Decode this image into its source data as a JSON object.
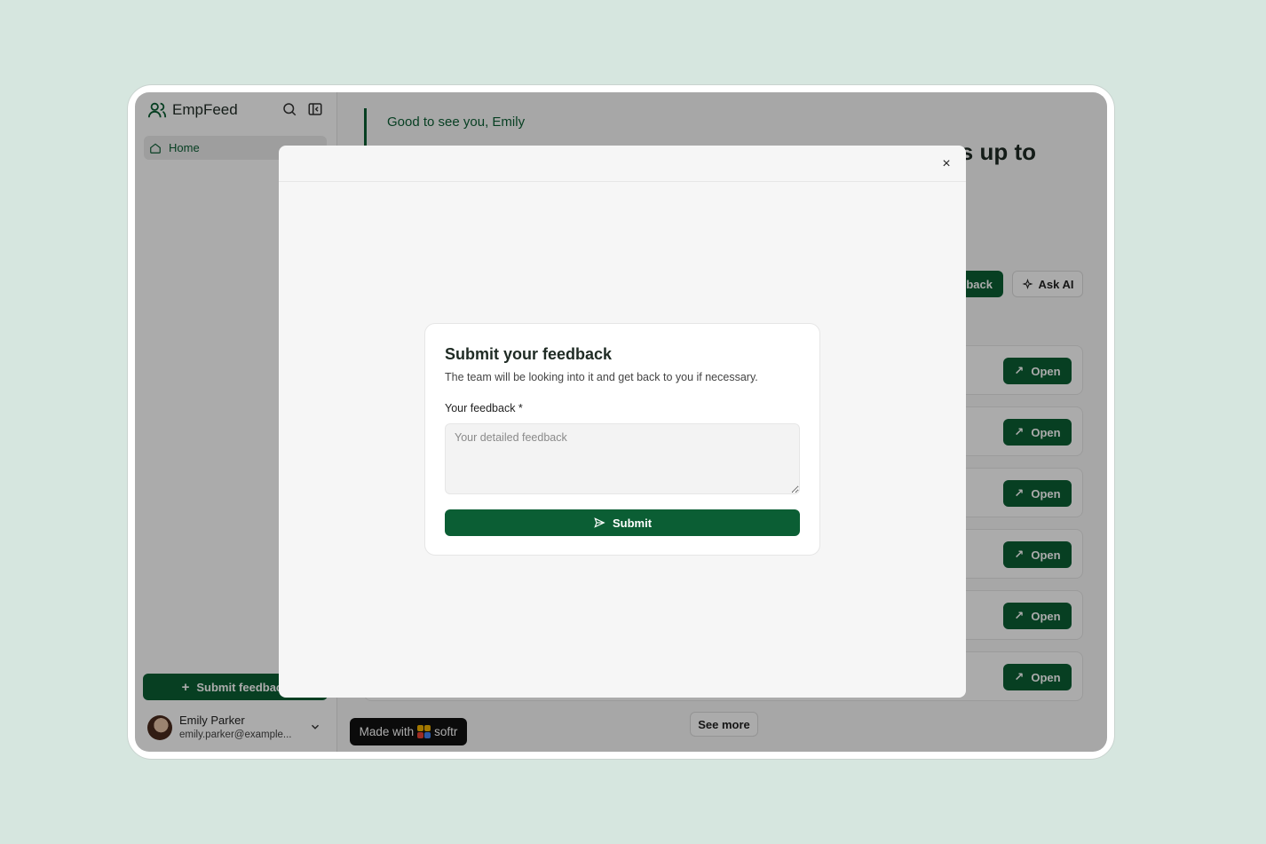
{
  "app": {
    "name": "EmpFeed"
  },
  "sidebar": {
    "nav_items": [
      {
        "label": "Home",
        "icon": "home-icon"
      }
    ],
    "submit_feedback_label": "Submit feedback",
    "user": {
      "name": "Emily Parker",
      "email": "emily.parker@example..."
    }
  },
  "main": {
    "greeting": "Good to see you, Emily",
    "headline_visible_tail": "s up to",
    "give_feedback_label": "back",
    "ask_ai_label": "Ask AI",
    "open_label": "Open",
    "see_more_label": "See more",
    "made_with_label": "Made with",
    "made_with_brand": "softr"
  },
  "modal": {
    "close_symbol": "×",
    "title": "Submit your feedback",
    "description": "The team will be looking into it and get back to you if necessary.",
    "field_label": "Your feedback *",
    "field_placeholder": "Your detailed feedback",
    "field_value": "",
    "submit_label": "Submit"
  },
  "colors": {
    "brand": "#0b5e34",
    "background": "#d6e6df"
  }
}
